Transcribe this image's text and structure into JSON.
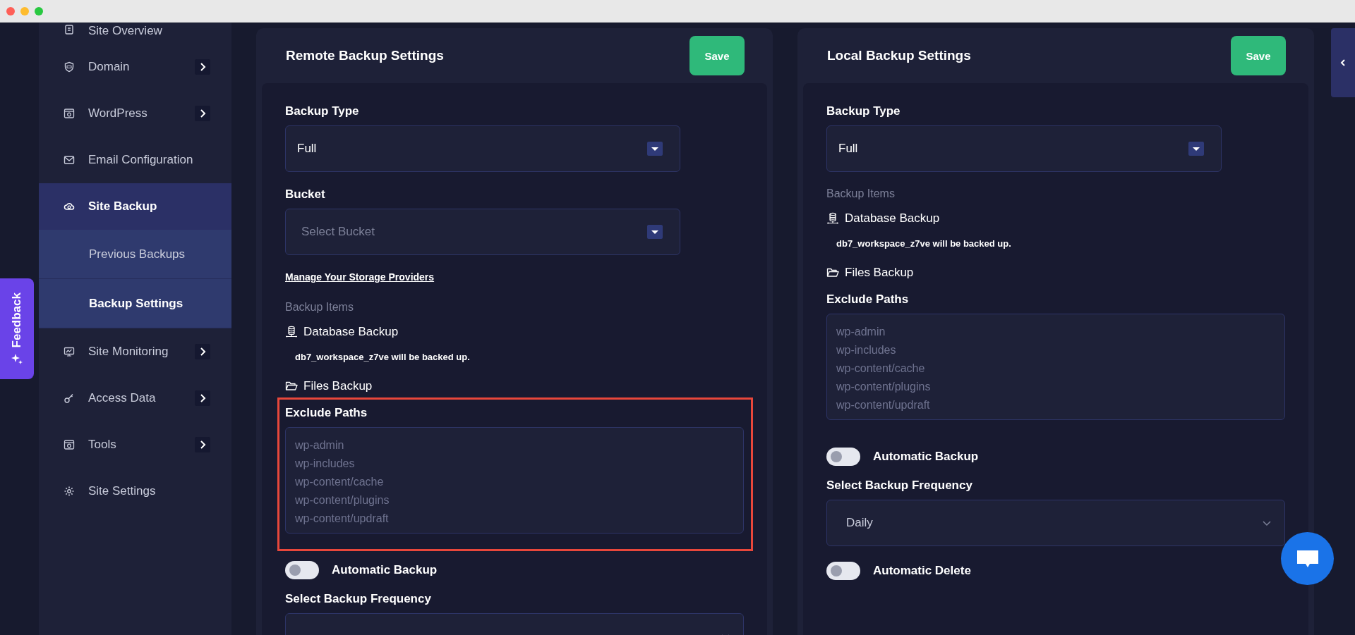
{
  "sidebar": {
    "items": [
      {
        "label": "Site Overview",
        "expandable": false,
        "selected": false
      },
      {
        "label": "Domain",
        "expandable": true,
        "selected": false
      },
      {
        "label": "WordPress",
        "expandable": true,
        "selected": false
      },
      {
        "label": "Email Configuration",
        "expandable": false,
        "selected": false
      },
      {
        "label": "Site Backup",
        "expandable": false,
        "selected": true,
        "children": [
          {
            "label": "Previous Backups",
            "selected": false
          },
          {
            "label": "Backup Settings",
            "selected": true
          }
        ]
      },
      {
        "label": "Site Monitoring",
        "expandable": true,
        "selected": false
      },
      {
        "label": "Access Data",
        "expandable": true,
        "selected": false
      },
      {
        "label": "Tools",
        "expandable": true,
        "selected": false
      },
      {
        "label": "Site Settings",
        "expandable": false,
        "selected": false
      }
    ]
  },
  "feedback_tab": {
    "label": "Feedback"
  },
  "panels": [
    {
      "title": "Remote Backup Settings",
      "save_button": "Save",
      "fields": [
        {
          "kind": "select",
          "label": "Backup Type",
          "value": "Full"
        },
        {
          "kind": "select",
          "label": "Bucket",
          "placeholder": "Select Bucket"
        },
        {
          "kind": "link",
          "text": "Manage Your Storage Providers"
        },
        {
          "kind": "caption",
          "text": "Backup Items"
        },
        {
          "kind": "database",
          "text": "Database Backup"
        },
        {
          "kind": "note",
          "text": "db7_workspace_z7ve will be backed up."
        },
        {
          "kind": "files",
          "text": "Files Backup"
        },
        {
          "kind": "textarea",
          "label": "Exclude Paths",
          "placeholder": "wp-admin\nwp-includes\nwp-content/cache\nwp-content/plugins\nwp-content/updraft",
          "highlighted": true
        },
        {
          "kind": "toggle",
          "label": "Automatic Backup",
          "on": false
        },
        {
          "kind": "dropdown",
          "label": "Select Backup Frequency"
        }
      ]
    },
    {
      "title": "Local Backup Settings",
      "save_button": "Save",
      "fields": [
        {
          "kind": "select",
          "label": "Backup Type",
          "value": "Full"
        },
        {
          "kind": "caption",
          "text": "Backup Items"
        },
        {
          "kind": "database",
          "text": "Database Backup"
        },
        {
          "kind": "note",
          "text": "db7_workspace_z7ve will be backed up."
        },
        {
          "kind": "files",
          "text": "Files Backup"
        },
        {
          "kind": "textarea",
          "label": "Exclude Paths",
          "placeholder": "wp-admin\nwp-includes\nwp-content/cache\nwp-content/plugins\nwp-content/updraft",
          "highlighted": false
        },
        {
          "kind": "toggle",
          "label": "Automatic Backup",
          "on": false
        },
        {
          "kind": "dropdown",
          "label": "Select Backup Frequency",
          "value": "Daily"
        },
        {
          "kind": "toggle",
          "label": "Automatic Delete",
          "on": false
        }
      ]
    }
  ]
}
